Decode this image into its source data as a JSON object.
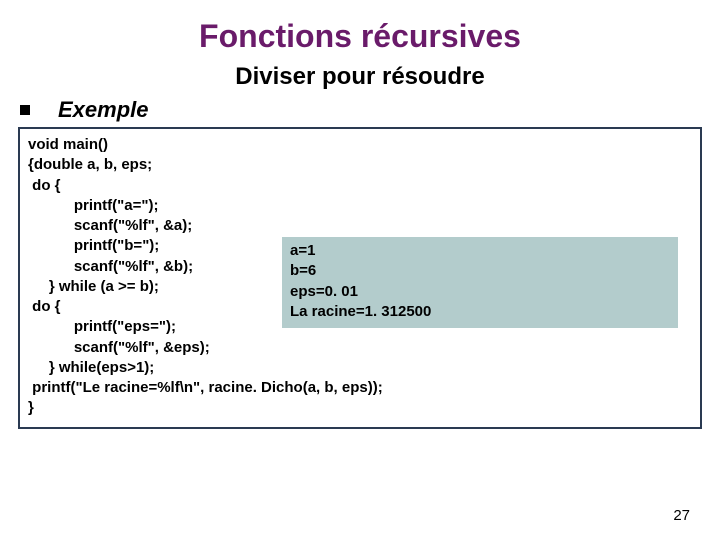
{
  "title": "Fonctions récursives",
  "subtitle": "Diviser pour résoudre",
  "section_label": "Exemple",
  "code": "void main()\n{double a, b, eps;\n do {\n           printf(\"a=\");\n           scanf(\"%lf\", &a);\n           printf(\"b=\");\n           scanf(\"%lf\", &b);\n     } while (a >= b);\n do {\n           printf(\"eps=\");\n           scanf(\"%lf\", &eps);\n     } while(eps>1);\n printf(\"Le racine=%lf\\n\", racine. Dicho(a, b, eps));\n}",
  "output": "a=1\nb=6\neps=0. 01\nLa racine=1. 312500",
  "page_number": "27"
}
